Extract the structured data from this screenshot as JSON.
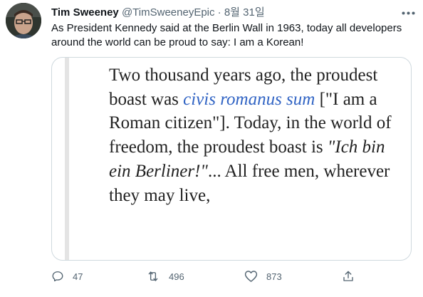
{
  "author": {
    "display_name": "Tim Sweeney",
    "handle": "@TimSweeneyEpic",
    "separator": "·",
    "date": "8월 31일"
  },
  "tweet_text": "As President Kennedy said at the Berlin Wall in 1963, today all developers around the world can be proud to say: I am a Korean!",
  "quote_image": {
    "t1": "Two thousand years ago, the proudest boast was ",
    "link_italic": "civis romanus sum",
    "t2": " [\"I am a Roman citizen\"]. Today, in the world of freedom, the proudest boast is ",
    "ich_italic": "\"Ich bin ein Berliner!\"",
    "t3": "... All free men, wherever they may live,"
  },
  "actions": {
    "reply_count": "47",
    "retweet_count": "496",
    "like_count": "873"
  },
  "icons": {
    "more": "more-icon",
    "reply": "reply-icon",
    "retweet": "retweet-icon",
    "like": "heart-icon",
    "share": "share-icon"
  }
}
